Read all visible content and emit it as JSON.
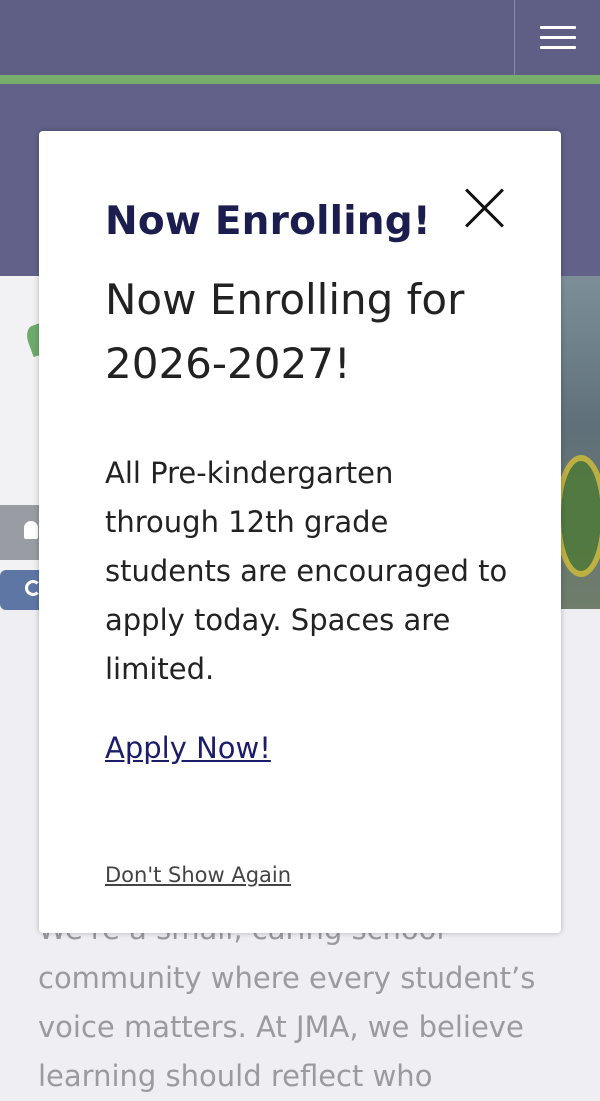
{
  "header": {
    "menu_icon": "hamburger-icon"
  },
  "background": {
    "body_lines": [
      "We're a small, caring school",
      "community where every student’s",
      "voice matters. At JMA, we believe",
      "learning should reflect who"
    ]
  },
  "modal": {
    "title": "Now Enrolling!",
    "subtitle_lines": [
      "Now Enrolling for",
      "2026-2027!"
    ],
    "body_lines": [
      "All Pre-kindergarten",
      "through 12th grade",
      "students are encouraged to",
      "apply today. Spaces are",
      "limited."
    ],
    "apply_link": "Apply Now!",
    "dont_show": "Don't Show Again",
    "close_icon": "close-icon"
  },
  "colors": {
    "header_purple": "#5f5f86",
    "accent_green": "#79ad6c",
    "title_navy": "#1c1d4f",
    "link_navy": "#1c1d6a"
  }
}
